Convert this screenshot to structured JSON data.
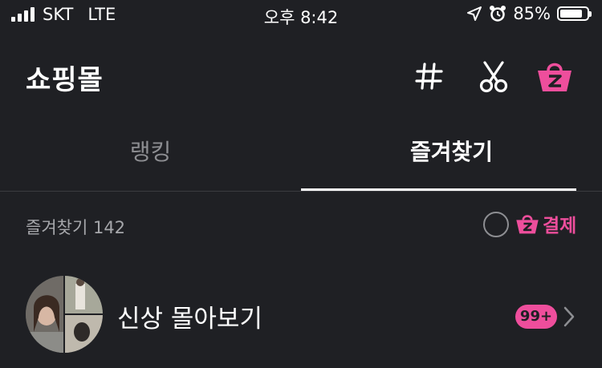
{
  "status_bar": {
    "carrier": "SKT",
    "network": "LTE",
    "time": "오후 8:42",
    "battery_percent": "85%",
    "battery_level": 0.85
  },
  "header": {
    "title": "쇼핑몰",
    "icons": [
      "hash-icon",
      "scissors-icon",
      "zigzag-basket-icon"
    ]
  },
  "tabs": [
    {
      "label": "랭킹",
      "active": false
    },
    {
      "label": "즐겨찾기",
      "active": true
    }
  ],
  "favorites": {
    "count_label": "즐겨찾기 142",
    "pay_label": "결제"
  },
  "list": {
    "items": [
      {
        "label": "신상 몰아보기",
        "badge": "99+"
      }
    ]
  },
  "colors": {
    "background": "#1f2024",
    "accent": "#ee4e9c",
    "muted": "#8d8e92"
  }
}
